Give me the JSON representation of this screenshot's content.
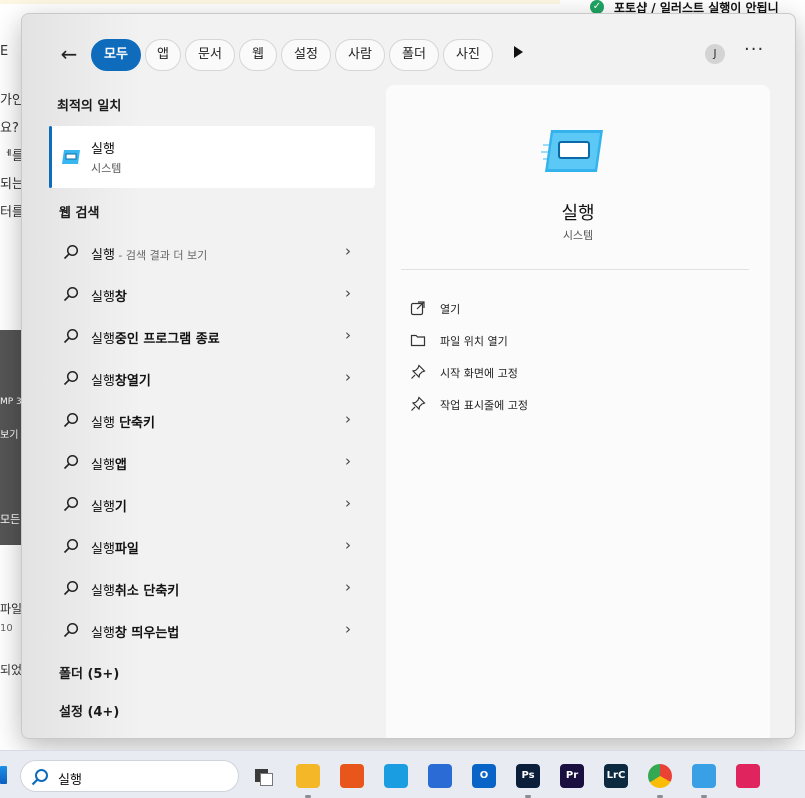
{
  "background": {
    "notice_text": "포토샵 / 일러스트 실행이 안됩니",
    "left_fragments": [
      "E",
      "가인",
      "요?",
      "ᅦ를",
      "되는",
      "터를",
      "MP 3",
      "보기",
      "모든",
      "파일",
      "10",
      "되었"
    ]
  },
  "filters": {
    "back_icon": "arrow-left-icon",
    "items": [
      {
        "label": "모두",
        "active": true
      },
      {
        "label": "앱",
        "active": false
      },
      {
        "label": "문서",
        "active": false
      },
      {
        "label": "웹",
        "active": false
      },
      {
        "label": "설정",
        "active": false
      },
      {
        "label": "사람",
        "active": false
      },
      {
        "label": "폴더",
        "active": false
      },
      {
        "label": "사진",
        "active": false
      }
    ],
    "more_icon": "play-icon",
    "avatar_initial": "J",
    "overflow_icon": "more-icon"
  },
  "results": {
    "best_match_heading": "최적의 일치",
    "best_match": {
      "title": "실행",
      "subtitle": "시스템",
      "icon": "run-dialog-icon"
    },
    "web_heading": "웹 검색",
    "web_items": [
      {
        "prefix": "실행",
        "bold": "",
        "suffix": " - 검색 결과 더 보기"
      },
      {
        "prefix": "실행",
        "bold": "창",
        "suffix": ""
      },
      {
        "prefix": "실행",
        "bold": "중인 프로그램 종료",
        "suffix": ""
      },
      {
        "prefix": "실행",
        "bold": "창열기",
        "suffix": ""
      },
      {
        "prefix": "실행 ",
        "bold": "단축키",
        "suffix": ""
      },
      {
        "prefix": "실행",
        "bold": "앱",
        "suffix": ""
      },
      {
        "prefix": "실행",
        "bold": "기",
        "suffix": ""
      },
      {
        "prefix": "실행",
        "bold": "파일",
        "suffix": ""
      },
      {
        "prefix": "실행",
        "bold": "취소 단축키",
        "suffix": ""
      },
      {
        "prefix": "실행",
        "bold": "창 띄우는법",
        "suffix": ""
      }
    ],
    "groups": [
      "폴더 (5+)",
      "설정 (4+)"
    ]
  },
  "details": {
    "title": "실행",
    "subtitle": "시스템",
    "icon": "run-dialog-icon",
    "actions": [
      {
        "label": "열기",
        "icon": "open-external-icon"
      },
      {
        "label": "파일 위치 열기",
        "icon": "folder-icon"
      },
      {
        "label": "시작 화면에 고정",
        "icon": "pin-icon"
      },
      {
        "label": "작업 표시줄에 고정",
        "icon": "pin-icon"
      }
    ]
  },
  "taskbar": {
    "search_value": "실행",
    "apps": [
      {
        "name": "task-view",
        "label": "",
        "color": "#3a3a3a"
      },
      {
        "name": "file-explorer",
        "label": "",
        "color": "#f3b728"
      },
      {
        "name": "app-orange",
        "label": "",
        "color": "#e8561c"
      },
      {
        "name": "edge",
        "label": "",
        "color": "#1b9de2"
      },
      {
        "name": "store",
        "label": "",
        "color": "#2b6bd6"
      },
      {
        "name": "outlook",
        "label": "O",
        "color": "#0a64c8"
      },
      {
        "name": "photoshop",
        "label": "Ps",
        "color": "#0b1e3a"
      },
      {
        "name": "premiere",
        "label": "Pr",
        "color": "#1b0f40"
      },
      {
        "name": "lightroom-classic",
        "label": "LrC",
        "color": "#0c2a3f"
      },
      {
        "name": "chrome",
        "label": "",
        "color": "#34a853"
      },
      {
        "name": "notepad",
        "label": "",
        "color": "#3aa0e6"
      },
      {
        "name": "creative-cloud",
        "label": "",
        "color": "#e0245e"
      }
    ]
  }
}
